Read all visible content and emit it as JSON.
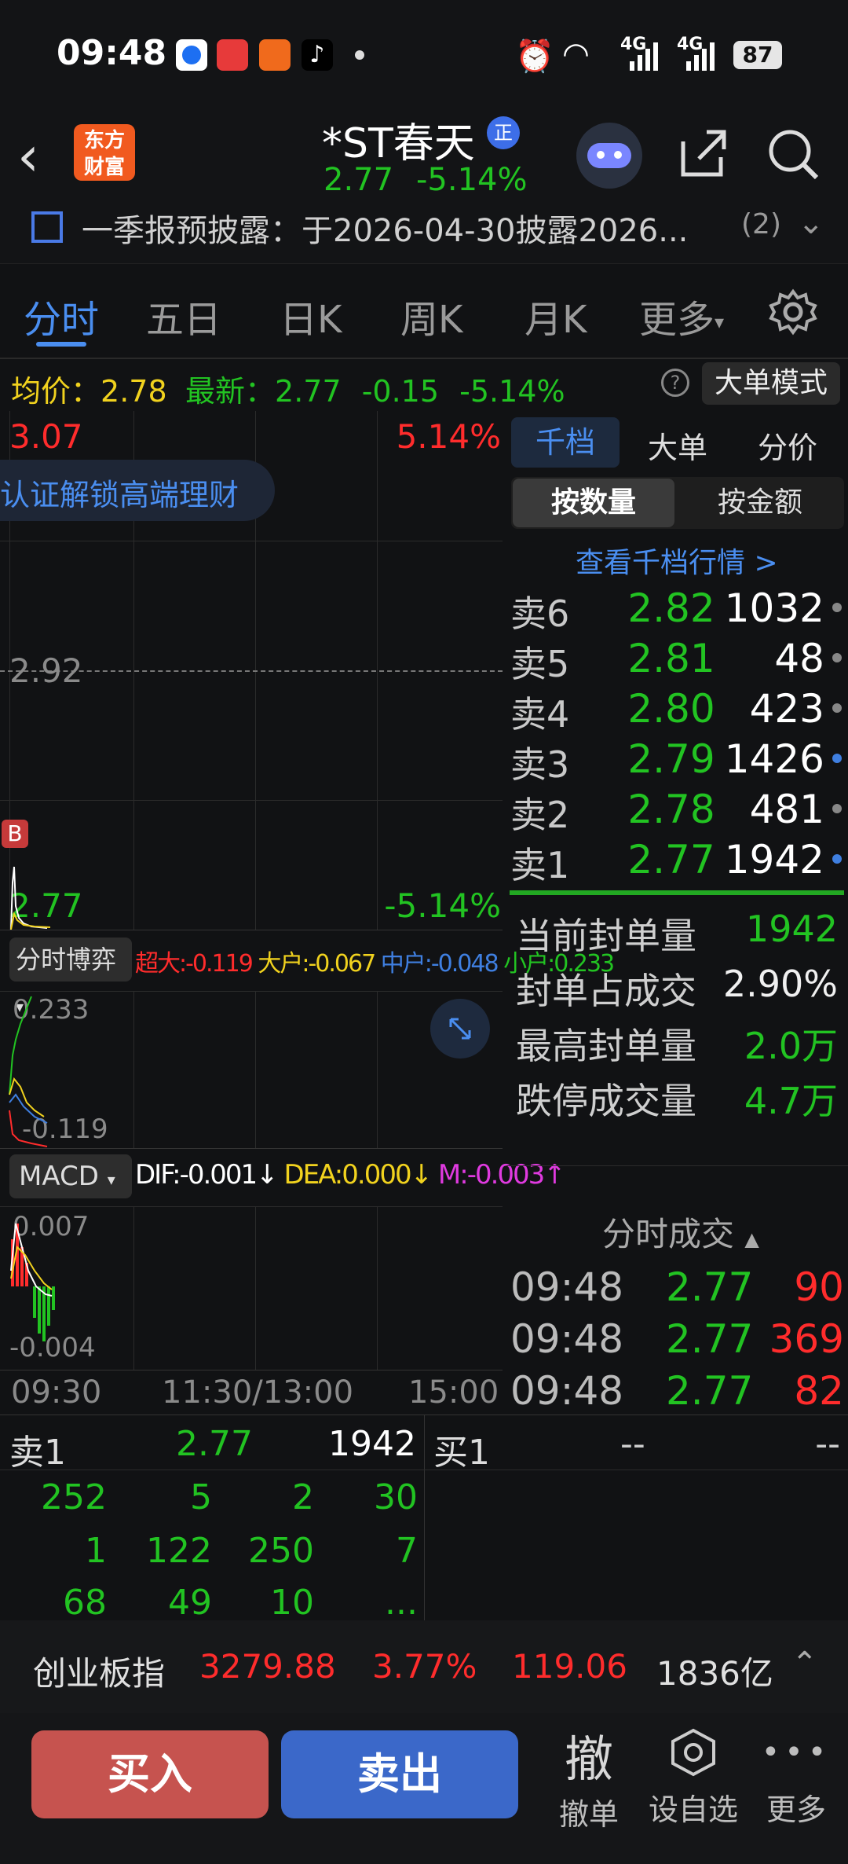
{
  "status": {
    "time": "09:48",
    "network1": "4G",
    "network2": "4G",
    "battery": "87"
  },
  "header": {
    "logo_line1": "东方",
    "logo_line2": "财富",
    "title": "*ST春天",
    "badge": "正",
    "price": "2.77",
    "change_pct": "-5.14%"
  },
  "announcement": {
    "text": "一季报预披露：于2026-04-30披露2026...",
    "count": "(2)"
  },
  "tabs": [
    "分时",
    "五日",
    "日K",
    "周K",
    "月K",
    "更多"
  ],
  "infobar": {
    "avg_label": "均价：",
    "avg_value": "2.78",
    "latest_label": "最新：",
    "latest_value": "2.77",
    "change": "-0.15",
    "change_pct": "-5.14%",
    "help": "?",
    "mode_button": "大单模式"
  },
  "chart": {
    "high_price": "3.07",
    "high_pct": "5.14%",
    "mid_price": "2.92",
    "low_price": "2.77",
    "low_pct": "-5.14%",
    "promo_text": "认证解锁高端理财",
    "b_marker": "B",
    "flow_selector": "分时博弈",
    "flow_super_label": "超大:",
    "flow_super": "-0.119",
    "flow_big_label": "大户:",
    "flow_big": "-0.067",
    "flow_mid_label": "中户:",
    "flow_mid": "-0.048",
    "flow_small_label": "小户:",
    "flow_small": "0.233",
    "flow_top": "0.233",
    "flow_bottom": "-0.119",
    "macd_selector": "MACD",
    "dif": "DIF:-0.001↓",
    "dea": "DEA:0.000↓",
    "m": "M:-0.003↑",
    "macd_top": "0.007",
    "macd_bottom": "-0.004",
    "time_start": "09:30",
    "time_mid": "11:30/13:00",
    "time_end": "15:00",
    "colors": {
      "up": "#ff2c2c",
      "down": "#22c322",
      "avg": "#f1d21e"
    }
  },
  "panel": {
    "tabs": [
      "千档",
      "大单",
      "分价"
    ],
    "subtabs": [
      "按数量",
      "按金额"
    ],
    "view_link": "查看千档行情 >",
    "asks": [
      {
        "label": "卖6",
        "price": "2.82",
        "vol": "1032"
      },
      {
        "label": "卖5",
        "price": "2.81",
        "vol": "48"
      },
      {
        "label": "卖4",
        "price": "2.80",
        "vol": "423"
      },
      {
        "label": "卖3",
        "price": "2.79",
        "vol": "1426"
      },
      {
        "label": "卖2",
        "price": "2.78",
        "vol": "481"
      },
      {
        "label": "卖1",
        "price": "2.77",
        "vol": "1942"
      }
    ],
    "stats": [
      {
        "k": "当前封单量",
        "v": "1942"
      },
      {
        "k": "封单占成交",
        "v": "2.90%"
      },
      {
        "k": "最高封单量",
        "v": "2.0万"
      },
      {
        "k": "跌停成交量",
        "v": "4.7万"
      }
    ],
    "trades_title": "分时成交",
    "trades": [
      {
        "t": "09:48",
        "p": "2.77",
        "v": "90"
      },
      {
        "t": "09:48",
        "p": "2.77",
        "v": "369"
      },
      {
        "t": "09:48",
        "p": "2.77",
        "v": "82"
      }
    ]
  },
  "queue": {
    "sell_label": "卖1",
    "sell_price": "2.77",
    "sell_vol": "1942",
    "buy_label": "买1",
    "buy_price": "--",
    "buy_vol": "--",
    "rows": [
      [
        "252",
        "5",
        "2",
        "30"
      ],
      [
        "1",
        "122",
        "250",
        "7"
      ],
      [
        "68",
        "49",
        "10",
        "..."
      ]
    ]
  },
  "index": {
    "name": "创业板指",
    "value": "3279.88",
    "pct": "3.77%",
    "change": "119.06",
    "amount": "1836亿"
  },
  "actions": {
    "buy": "买入",
    "sell": "卖出",
    "cancel_icon": "撤",
    "cancel": "撤单",
    "watch": "设自选",
    "more": "更多"
  }
}
